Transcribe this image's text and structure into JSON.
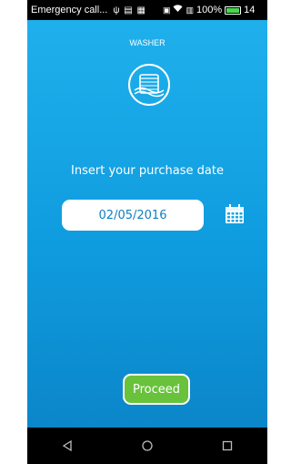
{
  "statusbar": {
    "notification": "Emergency call...",
    "battery_text": "100%",
    "time": "14",
    "battery_level": 1.0,
    "battery_color": "#48d650"
  },
  "header": {
    "title": "WASHER",
    "icon": "washer-icon"
  },
  "main": {
    "prompt": "Insert your purchase date",
    "date_value": "02/05/2016",
    "calendar_icon": "calendar-icon"
  },
  "footer": {
    "proceed_label": "Proceed",
    "proceed_color": "#68c23c"
  },
  "navbar": {
    "back_icon": "back-triangle-icon",
    "home_icon": "home-circle-icon",
    "recents_icon": "recents-square-icon"
  },
  "colors": {
    "background_top": "#1fb0ec",
    "background_bottom": "#0b86c9",
    "date_text": "#0d7fc0"
  }
}
